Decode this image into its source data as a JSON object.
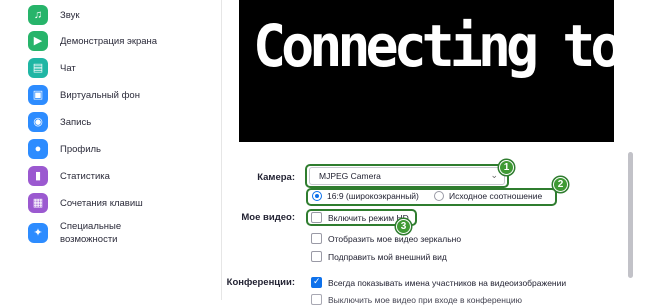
{
  "sidebar": {
    "items": [
      {
        "label": "Звук",
        "icon": "headphones-icon",
        "color": "#27b46a",
        "glyph": "♫"
      },
      {
        "label": "Демонстрация экрана",
        "icon": "share-screen-icon",
        "color": "#27b46a",
        "glyph": "▶"
      },
      {
        "label": "Чат",
        "icon": "chat-icon",
        "color": "#1fb6a4",
        "glyph": "▤"
      },
      {
        "label": "Виртуальный фон",
        "icon": "virtual-background-icon",
        "color": "#2d8cff",
        "glyph": "▣"
      },
      {
        "label": "Запись",
        "icon": "record-icon",
        "color": "#2d8cff",
        "glyph": "◉"
      },
      {
        "label": "Профиль",
        "icon": "profile-icon",
        "color": "#2d8cff",
        "glyph": "●"
      },
      {
        "label": "Статистика",
        "icon": "statistics-icon",
        "color": "#9b59d0",
        "glyph": "▮"
      },
      {
        "label": "Сочетания клавиш",
        "icon": "keyboard-icon",
        "color": "#9b59d0",
        "glyph": "▦"
      },
      {
        "label": "Специальные\nвозможности",
        "icon": "accessibility-icon",
        "color": "#2d8cff",
        "glyph": "✦"
      }
    ]
  },
  "preview": {
    "status_text": "Connecting to camera..."
  },
  "camera": {
    "label": "Камера:",
    "selected": "MJPEG Camera",
    "ratio_169": "16:9 (широкоэкранный)",
    "ratio_original": "Исходное соотношение"
  },
  "my_video": {
    "label": "Мое видео:",
    "hd": "Включить режим HD",
    "mirror": "Отобразить мое видео зеркально",
    "touch_up": "Подправить мой внешний вид"
  },
  "meetings": {
    "label": "Конференции:",
    "show_names": "Всегда показывать имена участников на видеоизображении",
    "next_partial": "Выключить мое видео при входе в конференцию"
  },
  "callouts": [
    "1",
    "2",
    "3"
  ],
  "accent_color": "#0e71eb",
  "callout_color": "#2f7d2f"
}
